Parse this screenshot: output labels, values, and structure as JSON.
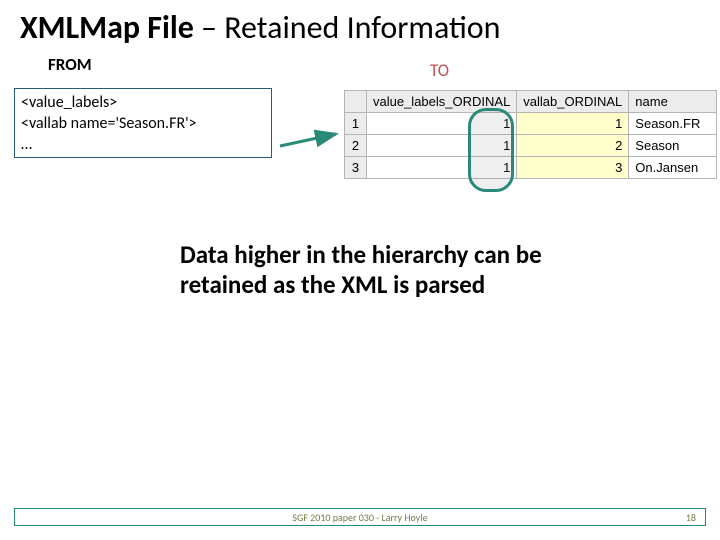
{
  "title_bold": "XMLMap File",
  "title_rest": " – Retained Information",
  "from_label": "FROM",
  "to_label": "TO",
  "xml_lines": {
    "l1": "<value_labels>",
    "l2": "<vallab name='Season.FR'>",
    "l3": "…"
  },
  "table": {
    "headers": {
      "h1": "value_labels_ORDINAL",
      "h2": "vallab_ORDINAL",
      "h3": "name"
    },
    "rows": [
      {
        "idx": "1",
        "a": "1",
        "b": "1",
        "c": "Season.FR"
      },
      {
        "idx": "2",
        "a": "1",
        "b": "2",
        "c": "Season"
      },
      {
        "idx": "3",
        "a": "1",
        "b": "3",
        "c": "On.Jansen"
      }
    ]
  },
  "caption": "Data higher in the hierarchy can be retained as the XML is parsed",
  "footer_center": "SGF 2010 paper 030 - Larry Hoyle",
  "footer_right": "18"
}
